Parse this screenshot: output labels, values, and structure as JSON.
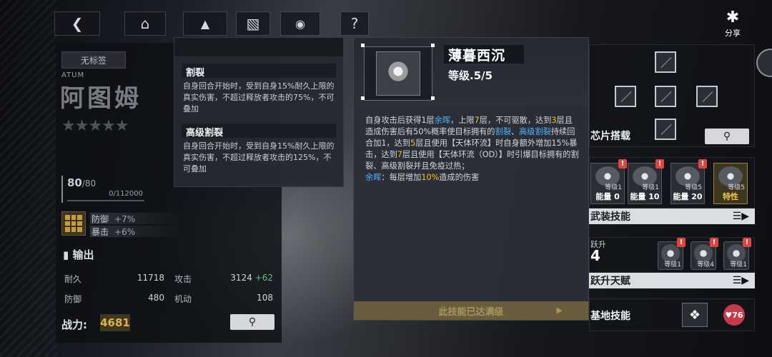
{
  "nav": {
    "back_icon": "chevron-left-icon",
    "home_icon": "home-icon",
    "hanger_icon": "hanger-icon",
    "book_icon": "book-icon",
    "gamepad_icon": "gamepad-icon",
    "help_icon": "question-icon",
    "share_label": "分享"
  },
  "character": {
    "tag": "无标签",
    "code": "ATUM",
    "name": "阿图姆",
    "stars": "★★★★★",
    "level_cur": "80",
    "level_max": "/80",
    "xp": "0/112000",
    "buffs": [
      {
        "label": "防御",
        "value": "+7%"
      },
      {
        "label": "暴击",
        "value": "+6%"
      }
    ],
    "section": "输出",
    "stats": [
      {
        "label": "耐久",
        "value": "11718"
      },
      {
        "label": "攻击",
        "value": "3124",
        "bonus": "+62"
      },
      {
        "label": "防御",
        "value": "480"
      },
      {
        "label": "机动",
        "value": "108"
      }
    ],
    "power_label": "战力:",
    "power_value": "4681"
  },
  "effects_tooltip": {
    "items": [
      {
        "title": "割裂",
        "desc": "自身回合开始时，受到自身15%耐久上限的真实伤害，不超过释放者攻击的75%，不可叠加"
      },
      {
        "title": "高级割裂",
        "desc": "自身回合开始时，受到自身15%耐久上限的真实伤害，不超过释放者攻击的125%，不可叠加"
      }
    ]
  },
  "skill": {
    "name": "薄暮西沉",
    "level": "等级.5/5",
    "desc": {
      "p1": "自身攻击后获得1层",
      "k1": "余晖",
      "p2": "，上限",
      "n1": "7",
      "p3": "层，不可驱散，达到",
      "n2": "3",
      "p4": "层且造成伤害后有50%概率使目标拥有的",
      "k2": "割裂",
      "p5": "、",
      "k3": "高级割裂",
      "p6": "持续回合加1，达到",
      "n3": "5",
      "p7": "层且使用【天体环流】时自身额外增加15%暴击，达到",
      "n4": "7",
      "p8": "层且使用【天体环流（OD）】时引爆目标拥有的割裂、高级割裂并且免疫过热；",
      "k4": "余晖",
      "p9": "：每层增加",
      "n5": "10%",
      "p10": "造成的伤害"
    },
    "max_label": "此技能已达满级"
  },
  "right_panel": {
    "chips_title": "芯片搭载",
    "equip": [
      {
        "label": "能量 0",
        "lv": "等级1"
      },
      {
        "label": "能量 10",
        "lv": "等级1"
      },
      {
        "label": "能量 20",
        "lv": "等级5"
      },
      {
        "label": "特性",
        "lv": "等级5"
      }
    ],
    "equip_skill": "武装技能",
    "ascend_label_1": "跃升",
    "ascend_num": "4",
    "talents": [
      {
        "lv": "等级1"
      },
      {
        "lv": "等级4"
      },
      {
        "lv": "等级1"
      }
    ],
    "ascend_talent": "跃升天赋",
    "base_skill": "基地技能",
    "heart_value": "76"
  },
  "colors": {
    "accent_blue": "#4fb4ff",
    "accent_yellow": "#f1c232",
    "bonus_green": "#56c47a",
    "badge_red": "#e0443f"
  }
}
